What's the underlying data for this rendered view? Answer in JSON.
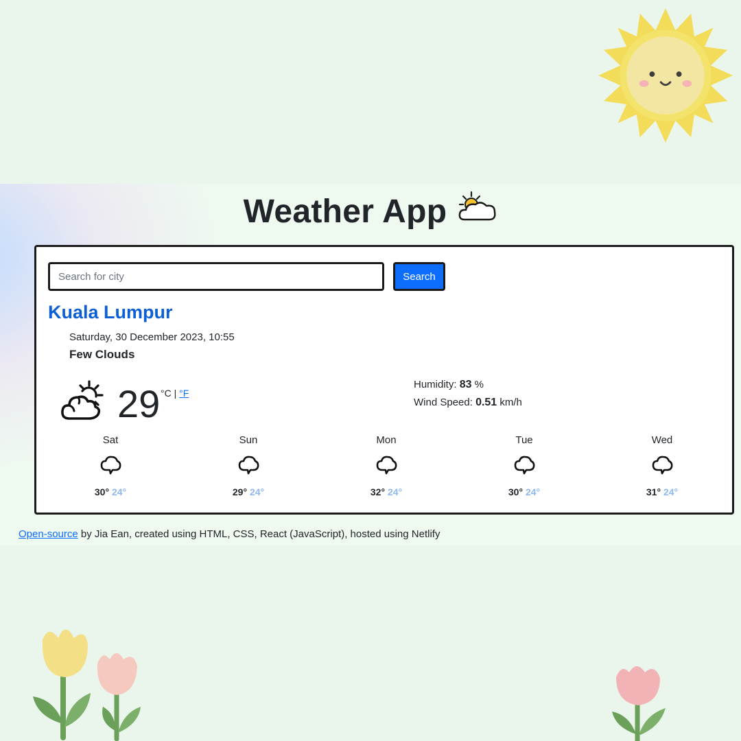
{
  "app": {
    "title": "Weather App"
  },
  "search": {
    "placeholder": "Search for city",
    "value": "",
    "button_label": "Search"
  },
  "current": {
    "city": "Kuala Lumpur",
    "datetime": "Saturday, 30 December 2023, 10:55",
    "description": "Few Clouds",
    "temperature": "29",
    "unit_celsius": "°C",
    "unit_separator": "|",
    "unit_fahrenheit": "°F",
    "humidity_label": "Humidity:",
    "humidity_value": "83",
    "humidity_unit": "%",
    "wind_label": "Wind Speed:",
    "wind_value": "0.51",
    "wind_unit": "km/h",
    "icon": "cloudy-sun-icon"
  },
  "forecast": [
    {
      "day": "Sat",
      "high": "30°",
      "low": "24°",
      "icon": "cloud-icon"
    },
    {
      "day": "Sun",
      "high": "29°",
      "low": "24°",
      "icon": "cloud-icon"
    },
    {
      "day": "Mon",
      "high": "32°",
      "low": "24°",
      "icon": "cloud-icon"
    },
    {
      "day": "Tue",
      "high": "30°",
      "low": "24°",
      "icon": "cloud-icon"
    },
    {
      "day": "Wed",
      "high": "31°",
      "low": "24°",
      "icon": "cloud-icon"
    }
  ],
  "footer": {
    "link_text": "Open-source",
    "text": " by Jia Ean, created using HTML, CSS, React (JavaScript), hosted using Netlify"
  },
  "colors": {
    "accent": "#0d6efd",
    "city": "#0d5fd6",
    "low_temp": "#8fb8ee",
    "background": "#eaf6ec"
  }
}
